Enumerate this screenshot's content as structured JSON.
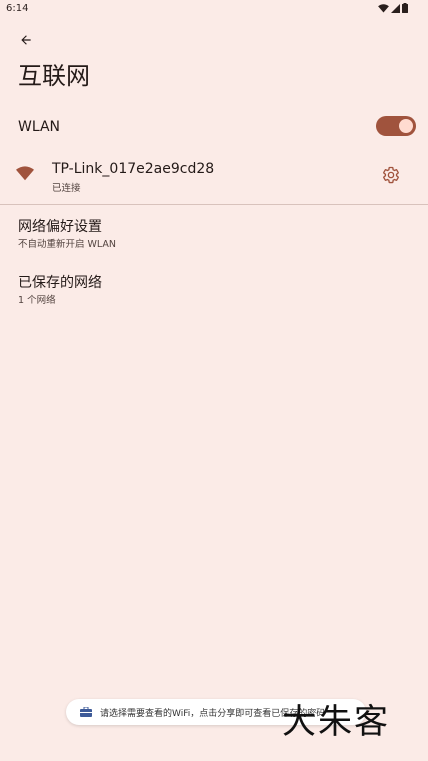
{
  "status_bar": {
    "time": "6:14",
    "icons": [
      "wifi-icon",
      "signal-icon",
      "battery-icon"
    ]
  },
  "header": {
    "title": "互联网"
  },
  "wlan": {
    "label": "WLAN",
    "enabled": true,
    "toggle_color": "#a0533d"
  },
  "network": {
    "ssid": "TP-Link_017e2ae9cd28",
    "status": "已连接",
    "icon_color": "#a0533d"
  },
  "preferences": [
    {
      "title": "网络偏好设置",
      "summary": "不自动重新开启 WLAN"
    },
    {
      "title": "已保存的网络",
      "summary": "1 个网络"
    }
  ],
  "toast": {
    "text": "请选择需要查看的WiFi，点击分享即可查看已保存的密码"
  },
  "watermark": {
    "text": "大朱客"
  }
}
